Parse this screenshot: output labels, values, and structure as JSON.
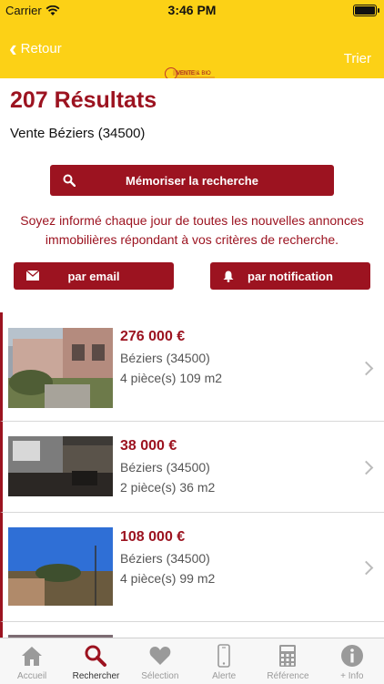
{
  "status": {
    "carrier": "Carrier",
    "time": "3:46 PM"
  },
  "nav": {
    "back_label": "Retour",
    "sort_label": "Trier",
    "logo_text": "VENTE & BIO"
  },
  "header": {
    "title": "207 Résultats",
    "subtitle": "Vente Béziers (34500)",
    "save_search_label": "Mémoriser la recherche",
    "info_text": "Soyez informé chaque jour de toutes les nouvelles annonces immobilières répondant à vos critères de recherche.",
    "email_label": "par email",
    "notification_label": "par notification"
  },
  "listings": [
    {
      "price": "276 000  €",
      "city": "Béziers (34500)",
      "details": "4 pièce(s) 109 m2"
    },
    {
      "price": "38 000  €",
      "city": "Béziers (34500)",
      "details": "2 pièce(s) 36 m2"
    },
    {
      "price": "108 000  €",
      "city": "Béziers (34500)",
      "details": "4 pièce(s) 99 m2"
    }
  ],
  "tabs": [
    {
      "label": "Accueil",
      "icon": "home-icon"
    },
    {
      "label": "Rechercher",
      "icon": "search-icon",
      "active": true
    },
    {
      "label": "Sélection",
      "icon": "heart-icon"
    },
    {
      "label": "Alerte",
      "icon": "phone-icon"
    },
    {
      "label": "Référence",
      "icon": "calculator-icon"
    },
    {
      "label": "+ Info",
      "icon": "info-icon"
    }
  ],
  "colors": {
    "brand_yellow": "#fcd116",
    "brand_red": "#9c1320"
  }
}
